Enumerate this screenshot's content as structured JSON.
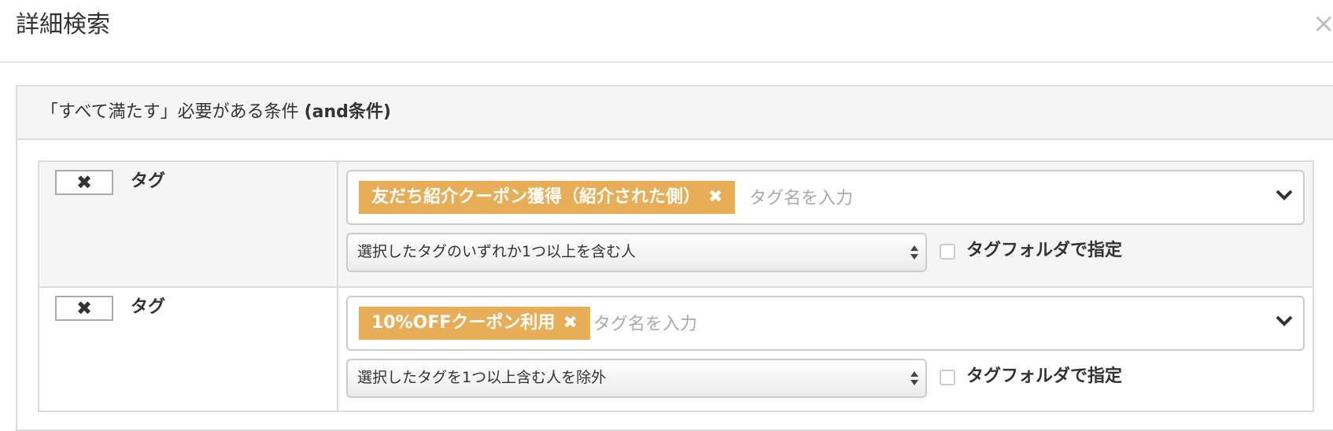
{
  "modal": {
    "title": "詳細検索",
    "close_label": "×"
  },
  "panel": {
    "title_main": "「すべて満たす」必要がある条件 ",
    "title_suffix": "(and条件)"
  },
  "conditions": [
    {
      "remove_label": "✖",
      "label": "タグ",
      "tag": "友だち紹介クーポン獲得（紹介された側）",
      "tag_remove": "✖",
      "input_placeholder": "タグ名を入力",
      "match_option": "選択したタグのいずれか1つ以上を含む人",
      "folder_label": "タグフォルダで指定",
      "folder_checked": false
    },
    {
      "remove_label": "✖",
      "label": "タグ",
      "tag": "10%OFFクーポン利用",
      "tag_remove": "✖",
      "input_placeholder": "タグ名を入力",
      "match_option": "選択したタグを1つ以上含む人を除外",
      "folder_label": "タグフォルダで指定",
      "folder_checked": false
    }
  ],
  "colors": {
    "tag_chip": "#e8ad57",
    "panel_heading_bg": "#f5f5f5",
    "border": "#dcdcdc"
  },
  "icons": {
    "remove": "x-icon",
    "dropdown": "chevron-down-icon",
    "select": "sort-arrows-icon"
  }
}
